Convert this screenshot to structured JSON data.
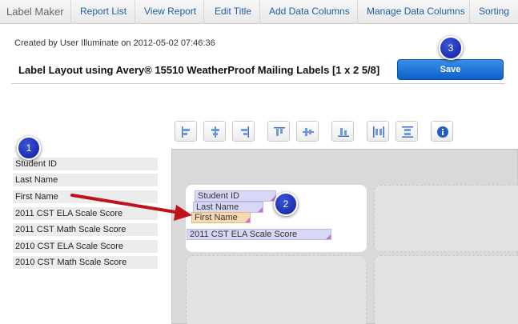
{
  "nav": {
    "brand": "Label Maker",
    "tabs": [
      "Report List",
      "View Report",
      "Edit Title",
      "Add Data Columns",
      "Manage Data Columns",
      "Sorting"
    ]
  },
  "header": {
    "created": "Created by User Illuminate on 2012-05-02 07:46:36",
    "title": "Label Layout using Avery® 15510 WeatherProof Mailing Labels [1 x 2 5/8]",
    "save_label": "Save"
  },
  "badges": [
    "1",
    "2",
    "3"
  ],
  "toolbar": {
    "icons": [
      "align-left-icon",
      "align-center-icon",
      "align-right-icon",
      "align-top-icon",
      "align-middle-icon",
      "align-bottom-icon",
      "distribute-horizontal-icon",
      "distribute-vertical-icon",
      "info-icon"
    ]
  },
  "fields": [
    "Student ID",
    "Last Name",
    "First Name",
    "2011 CST ELA Scale Score",
    "2011 CST Math Scale Score",
    "2010 CST ELA Scale Score",
    "2010 CST Math Scale Score"
  ],
  "label_items": [
    "Student ID",
    "Last Name",
    "First Name",
    "2011 CST ELA Scale Score"
  ],
  "colors": {
    "accent": "#1f5fa8",
    "save": "#0d5fc9",
    "badge": "#0c1f9e",
    "arrow": "#c0121a",
    "chip_blue": "#d6d8f5",
    "chip_orange": "#f7d9b0"
  }
}
